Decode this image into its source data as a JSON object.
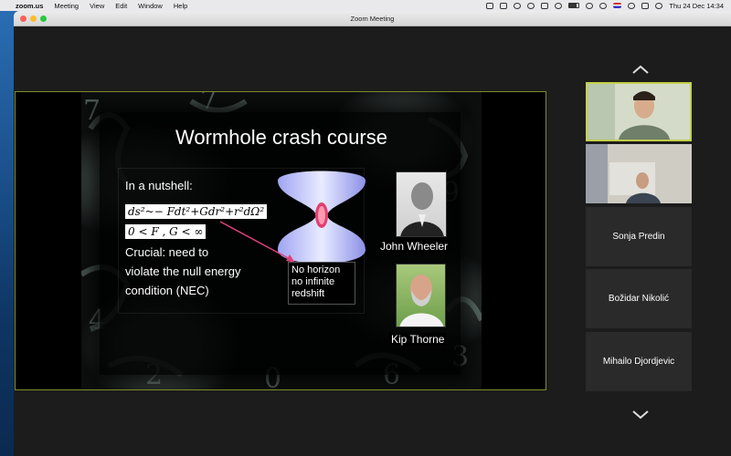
{
  "menubar": {
    "app": "zoom.us",
    "items": [
      "Meeting",
      "View",
      "Edit",
      "Window",
      "Help"
    ],
    "datetime": "Thu 24 Dec  14:34"
  },
  "window": {
    "title": "Zoom Meeting"
  },
  "slide": {
    "title": "Wormhole crash course",
    "intro": "In a nutshell:",
    "equation_metric": "ds²~− Fdt²+Gdr²+r²dΩ²",
    "equation_condition": "0  <  F , G  <  ∞",
    "crucial_lines": [
      "Crucial: need to",
      "violate the null energy",
      "condition (NEC)"
    ],
    "caption_lines": [
      "No horizon",
      "no infinite",
      "redshift"
    ],
    "people": [
      {
        "name": "John Wheeler"
      },
      {
        "name": "Kip Thorne"
      }
    ]
  },
  "participants": [
    {
      "name": "Sonja Predin"
    },
    {
      "name": "Božidar Nikolić"
    },
    {
      "name": "Mihailo Djordjevic"
    }
  ],
  "colors": {
    "active_speaker_border": "#c4d04a",
    "share_border": "#7f8b2a",
    "arrow": "#e0407a"
  }
}
